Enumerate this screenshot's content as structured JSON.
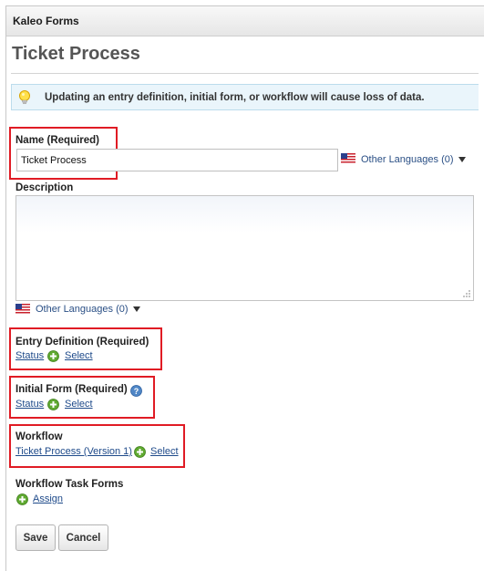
{
  "portlet": {
    "title": "Kaleo Forms"
  },
  "page": {
    "title": "Ticket Process"
  },
  "alert": {
    "message": "Updating an entry definition, initial form, or workflow will cause loss of data."
  },
  "name_field": {
    "label": "Name (Required)",
    "value": "Ticket Process",
    "other_languages": "Other Languages (0)"
  },
  "description_field": {
    "label": "Description",
    "other_languages": "Other Languages (0)"
  },
  "entry_definition": {
    "label": "Entry Definition (Required)",
    "value": "Status",
    "action": "Select"
  },
  "initial_form": {
    "label": "Initial Form (Required)",
    "value": "Status",
    "action": "Select"
  },
  "workflow": {
    "label": "Workflow",
    "value": "Ticket Process (Version 1)",
    "action": "Select"
  },
  "workflow_task_forms": {
    "label": "Workflow Task Forms",
    "action": "Assign"
  },
  "buttons": {
    "save": "Save",
    "cancel": "Cancel"
  },
  "colors": {
    "highlight": "#e01b24",
    "link": "#1e4a8a",
    "add_icon": "#5fa930",
    "info_bg": "#eaf5fb"
  },
  "icons": [
    "lightbulb-icon",
    "us-flag-icon",
    "caret-down-icon",
    "add-icon",
    "help-icon",
    "resize-handle-icon"
  ]
}
